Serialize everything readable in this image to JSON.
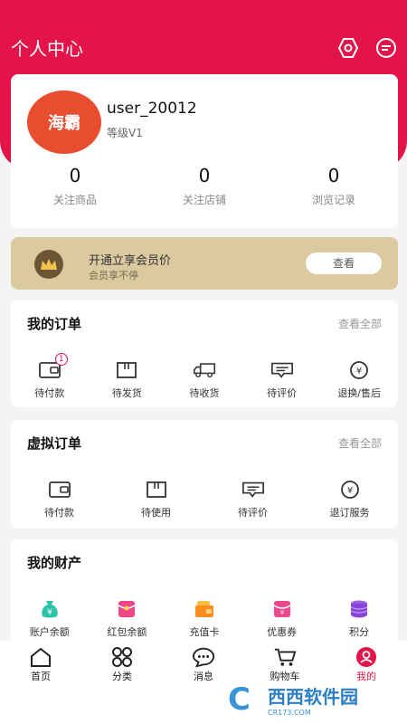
{
  "header": {
    "title": "个人中心"
  },
  "profile": {
    "avatar_text": "海霸",
    "username": "user_20012",
    "level": "等级V1",
    "stats": [
      {
        "value": "0",
        "label": "关注商品"
      },
      {
        "value": "0",
        "label": "关注店铺"
      },
      {
        "value": "0",
        "label": "浏览记录"
      }
    ]
  },
  "vip": {
    "title": "开通立享会员价",
    "subtitle": "会员享不停",
    "button": "查看"
  },
  "orders": {
    "title": "我的订单",
    "more": "查看全部",
    "badge": "1",
    "items": [
      "待付款",
      "待发货",
      "待收货",
      "待评价",
      "退换/售后"
    ]
  },
  "virtual_orders": {
    "title": "虚拟订单",
    "more": "查看全部",
    "items": [
      "待付款",
      "待使用",
      "待评价",
      "退订服务"
    ]
  },
  "assets": {
    "title": "我的财产",
    "items": [
      "账户余额",
      "红包余额",
      "充值卡",
      "优惠券",
      "积分"
    ]
  },
  "tabbar": {
    "items": [
      "首页",
      "分类",
      "消息",
      "购物车",
      "我的"
    ],
    "active": "我的"
  },
  "watermark": {
    "text": "西西软件园",
    "sub": "CR173.COM"
  },
  "colors": {
    "brand": "#e2144a",
    "vip_bg": "#dbc9a0",
    "page_bg": "#f4f4f4"
  }
}
